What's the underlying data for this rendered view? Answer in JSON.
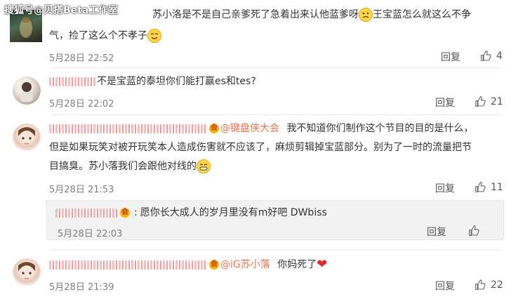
{
  "watermark": "搜狐号@贝搭Beta工作室",
  "comments": [
    {
      "text_a": "苏小洛是不是自己亲爹死了急着出来认他蓝爹呀",
      "text_b": "王宝蓝怎么就这么不争",
      "text_c": "气，捡了这么个不孝子",
      "time": "5月28日 22:52",
      "reply_label": "回复",
      "likes": "4"
    },
    {
      "text": "不是宝蓝的泰坦你们能打赢es和tes?",
      "time": "5月28日 22:02",
      "reply_label": "回复",
      "likes": "21"
    },
    {
      "mention": "@键盘侠大会",
      "text_a": "我不知道你们制作这个节目的目的是什么，",
      "text_b": "但是如果玩笑对被开玩笑本人造成伤害就不应该了，麻烦剪辑掉宝蓝部分。别为了一时的流量把节",
      "text_c": "目搞臭。苏小落我们会跟他对线的",
      "time": "5月28日 21:53",
      "reply_label": "回复",
      "likes": "11",
      "sub_reply": {
        "text": "愿你长大成人的岁月里没有m好吧 DWbiss",
        "time": "5月28日 22:03",
        "reply_label": "回复"
      }
    },
    {
      "mention": "@iG苏小落",
      "text": "你妈死了",
      "time": "5月28日 21:39",
      "reply_label": "回复",
      "likes": "22"
    }
  ],
  "colors": {
    "link": "#eb7350",
    "meta": "#808080",
    "emoji": "#ffd64a",
    "heart": "#e02a2a"
  }
}
